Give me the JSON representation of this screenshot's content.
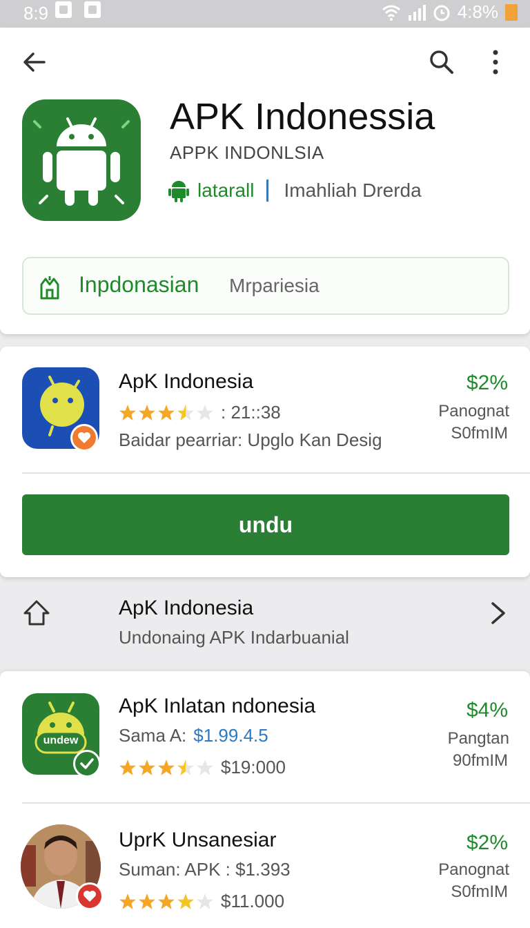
{
  "status_bar": {
    "time": "8:9",
    "battery": "4:8%"
  },
  "header": {
    "app_title": "APK Indonessia",
    "app_subtitle": "APPK INDONLSIA",
    "developer": "latarall",
    "category": "Imahliah Drerda",
    "region_main": "Inpdonasian",
    "region_sub": "Mrpariesia"
  },
  "main_app": {
    "name": "ApK Indonesia",
    "rating_stars": 3.5,
    "rating_value": ": 21::38",
    "detail": "Baidar pearriar:  Upglo Kan Desig",
    "price": "$2%",
    "price_label": "Panognat",
    "size": "S0fmIM",
    "download_label": "undu"
  },
  "nav": {
    "title": "ApK Indonesia",
    "subtitle": "Undonaing APK Indarbuanial"
  },
  "list": [
    {
      "name": "ApK Inlatan ndonesia",
      "line2_prefix": "Sama A:",
      "line2_value": "$1.99.4.5",
      "rating_stars": 3.5,
      "line3": "$19:000",
      "icon_text": "undew",
      "price": "$4%",
      "price_label": "Pangtan",
      "size": "90fmIM"
    },
    {
      "name": "UprK Unsanesiar",
      "line2": "Suman:  APK  :  $1.393",
      "rating_stars": 4,
      "line3": "$11.000",
      "price": "$2%",
      "price_label": "Panognat",
      "size": "S0fmIM"
    }
  ],
  "colors": {
    "primary_green": "#2a7f34",
    "price_green": "#1f8a2a",
    "star_gold": "#f5a623",
    "link_blue": "#2b7bc4"
  }
}
